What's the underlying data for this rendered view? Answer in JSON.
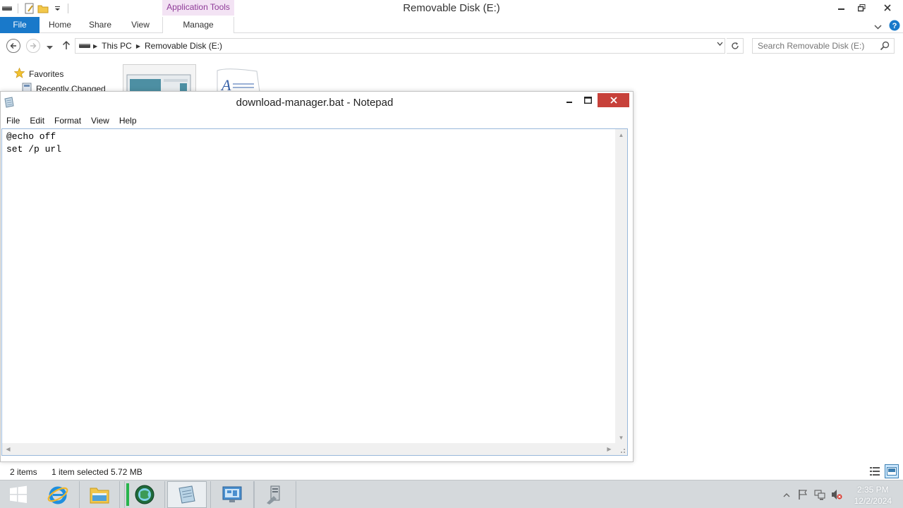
{
  "explorer": {
    "window_title": "Removable Disk (E:)",
    "contextual_group": "Application Tools",
    "ribbon_tabs": [
      "File",
      "Home",
      "Share",
      "View",
      "Manage"
    ],
    "address": {
      "crumbs": [
        "This PC",
        "Removable Disk (E:)"
      ]
    },
    "search": {
      "placeholder": "Search Removable Disk (E:)"
    },
    "nav_pane": {
      "favorites": "Favorites",
      "recently_changed": "Recently Changed"
    },
    "status": {
      "items": "2 items",
      "selected": "1 item selected  5.72 MB"
    }
  },
  "notepad": {
    "title": "download-manager.bat - Notepad",
    "menu": [
      "File",
      "Edit",
      "Format",
      "View",
      "Help"
    ],
    "content_lines": [
      "@echo off",
      "set /p url"
    ]
  },
  "taskbar": {
    "pinned": [
      "internet-explorer",
      "file-explorer",
      "network-app",
      "notepad",
      "server-manager",
      "system-tool"
    ],
    "time": "2:35 PM",
    "date": "12/2/2024"
  },
  "colors": {
    "file_tab": "#1979ca",
    "app_tools_bg": "#f3e3f4",
    "app_tools_text": "#8f3b98",
    "close_red": "#c7413a",
    "taskbar": "#d5d9dc"
  }
}
